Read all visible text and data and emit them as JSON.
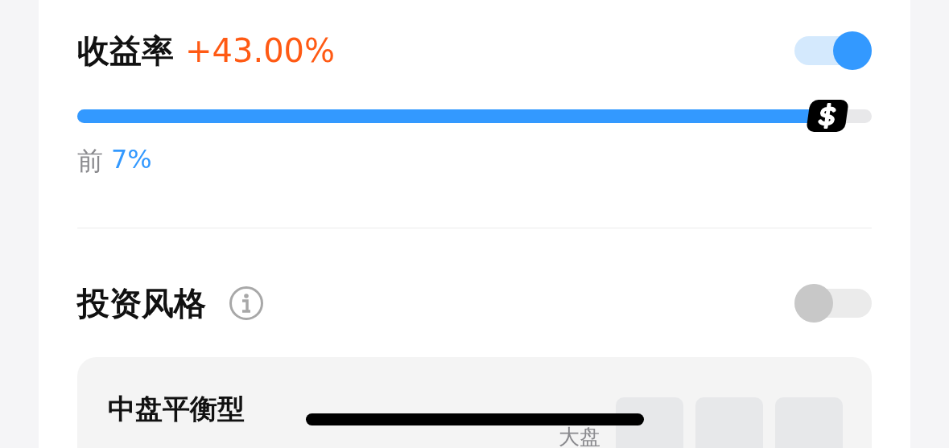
{
  "return_section": {
    "label": "收益率",
    "value": "+43.00%",
    "toggle_on": true,
    "level": 0.95,
    "rank_prefix": "前",
    "rank_value": "7%"
  },
  "style_section": {
    "label": "投资风格",
    "toggle_on": false,
    "style_card": {
      "title": "中盘平衡型",
      "axis_label": "大盘",
      "cells": [
        {
          "selected": false
        },
        {
          "selected": false
        },
        {
          "selected": false
        }
      ]
    }
  }
}
